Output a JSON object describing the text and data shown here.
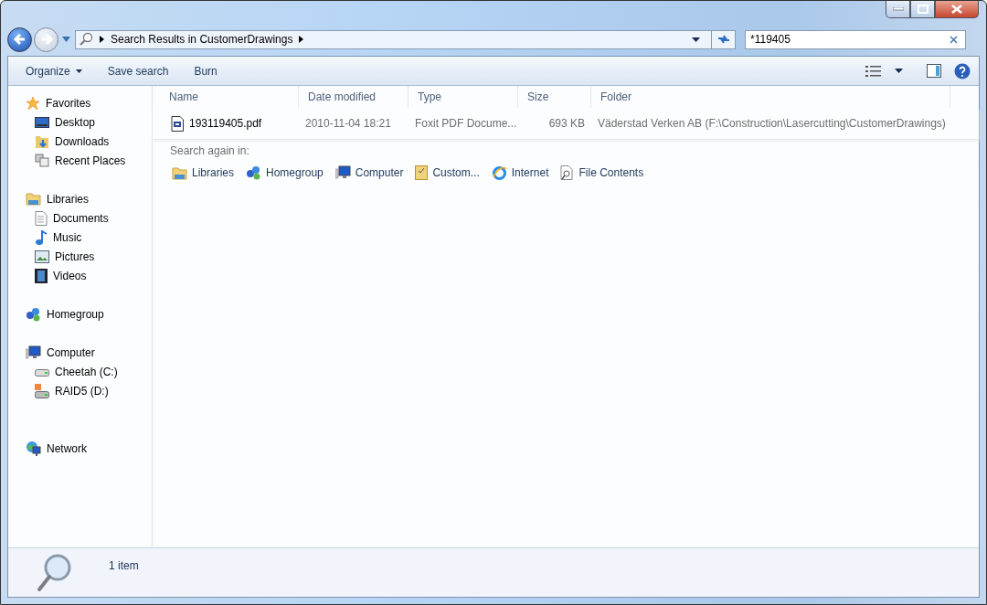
{
  "address_bar": {
    "path": "Search Results in CustomerDrawings"
  },
  "search": {
    "value": "*119405"
  },
  "toolbar": {
    "items": [
      {
        "label": "Organize",
        "dropdown": true
      },
      {
        "label": "Save search",
        "dropdown": false
      },
      {
        "label": "Burn",
        "dropdown": false
      }
    ]
  },
  "sidebar": {
    "groups": [
      {
        "label": "Favorites",
        "children": [
          {
            "label": "Desktop"
          },
          {
            "label": "Downloads"
          },
          {
            "label": "Recent Places"
          }
        ]
      },
      {
        "label": "Libraries",
        "children": [
          {
            "label": "Documents"
          },
          {
            "label": "Music"
          },
          {
            "label": "Pictures"
          },
          {
            "label": "Videos"
          }
        ]
      },
      {
        "label": "Homegroup"
      },
      {
        "label": "Computer",
        "children": [
          {
            "label": "Cheetah (C:)"
          },
          {
            "label": "RAID5 (D:)"
          }
        ]
      },
      {
        "label": "Network"
      }
    ]
  },
  "table": {
    "columns": [
      "Name",
      "Date modified",
      "Type",
      "Size",
      "Folder"
    ],
    "rows": [
      {
        "name": "193119405.pdf",
        "date": "2010-11-04 18:21",
        "type": "Foxit PDF Docume...",
        "size": "693 KB",
        "folder": "Väderstad Verken AB (F:\\Construction\\Lasercutting\\CustomerDrawings)"
      }
    ]
  },
  "search_again": {
    "label": "Search again in:",
    "locations": [
      "Libraries",
      "Homegroup",
      "Computer",
      "Custom...",
      "Internet",
      "File Contents"
    ]
  },
  "status_bar": {
    "text": "1 item"
  }
}
